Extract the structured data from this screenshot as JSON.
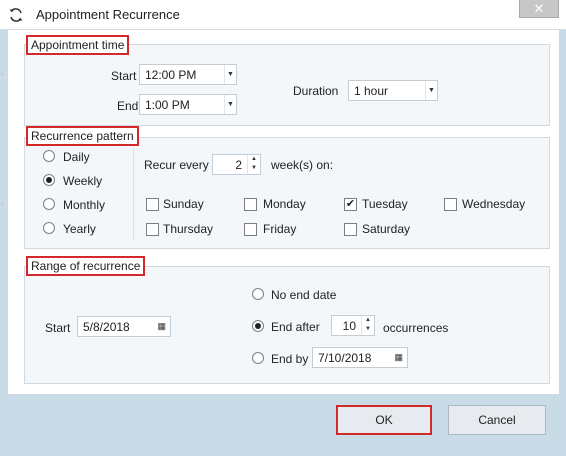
{
  "window": {
    "title": "Appointment Recurrence",
    "close_glyph": "✕"
  },
  "appointment_time": {
    "title": "Appointment time",
    "start_label": "Start",
    "start_value": "12:00 PM",
    "end_label": "End",
    "end_value": "1:00 PM",
    "duration_label": "Duration",
    "duration_value": "1 hour"
  },
  "recurrence_pattern": {
    "title": "Recurrence pattern",
    "options": [
      "Daily",
      "Weekly",
      "Monthly",
      "Yearly"
    ],
    "selected": "Weekly",
    "recur_every_label": "Recur every",
    "recur_every_value": "2",
    "recur_every_suffix": "week(s) on:",
    "days": [
      {
        "label": "Sunday",
        "checked": false
      },
      {
        "label": "Monday",
        "checked": false
      },
      {
        "label": "Tuesday",
        "checked": true
      },
      {
        "label": "Wednesday",
        "checked": false
      },
      {
        "label": "Thursday",
        "checked": false
      },
      {
        "label": "Friday",
        "checked": false
      },
      {
        "label": "Saturday",
        "checked": false
      }
    ]
  },
  "range_of_recurrence": {
    "title": "Range of recurrence",
    "start_label": "Start",
    "start_value": "5/8/2018",
    "no_end_label": "No end date",
    "end_after_label": "End after",
    "end_after_value": "10",
    "occurrences_label": "occurrences",
    "end_by_label": "End by",
    "end_by_value": "7/10/2018",
    "selected": "End after"
  },
  "footer": {
    "ok_label": "OK",
    "cancel_label": "Cancel"
  },
  "icons": {
    "title": "recurrence-cycle-icon",
    "dropdown": "chevron-down-icon",
    "calendar": "calendar-icon",
    "spin_up": "spin-up-icon",
    "spin_down": "spin-down-icon"
  },
  "colors": {
    "highlight_red": "#d22a2a",
    "footer_bg": "#c9dbe7"
  }
}
